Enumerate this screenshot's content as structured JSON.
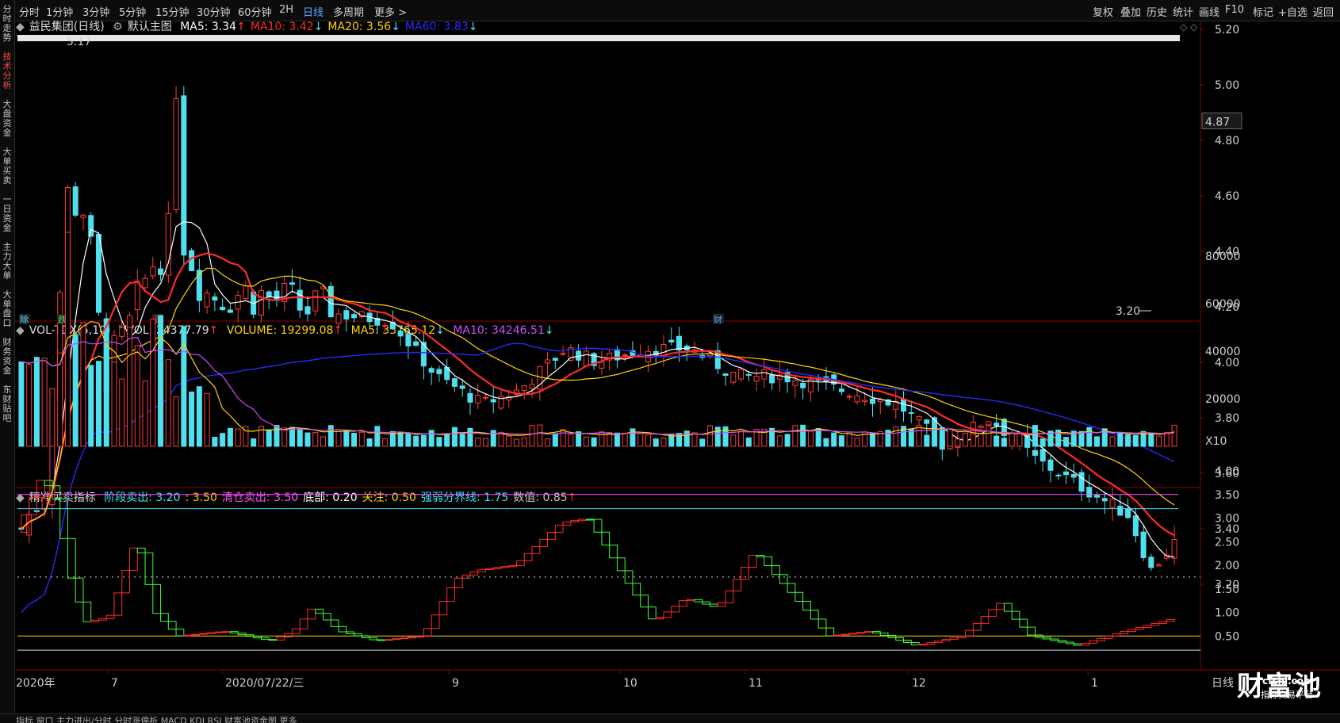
{
  "toolbar": {
    "periods": [
      "分时",
      "1分钟",
      "3分钟",
      "5分钟",
      "15分钟",
      "30分钟",
      "60分钟",
      "2H",
      "日线",
      "多周期",
      "更多 >"
    ],
    "active_period": "日线",
    "right_items": [
      "复权",
      "叠加",
      "历史",
      "统计",
      "画线",
      "F10",
      "标记",
      "+自选",
      "返回"
    ]
  },
  "leftbar": {
    "items": [
      "分时走势",
      "技术分析",
      "大盘资金",
      "大单买卖",
      "一日资金",
      "主力大单",
      "大单盘口",
      "财务资金",
      "东财贴吧"
    ],
    "active": "技术分析"
  },
  "main_chart": {
    "title": "益民集团(日线)",
    "template": "默认主图",
    "ma": [
      {
        "label": "MA5: 3.34",
        "arrow": "↑",
        "color": "#ffffff"
      },
      {
        "label": "MA10: 3.42",
        "arrow": "↓",
        "color": "#ff2a2a"
      },
      {
        "label": "MA20: 3.56",
        "arrow": "↓",
        "color": "#ffd400"
      },
      {
        "label": "MA60: 3.83",
        "arrow": "↓",
        "color": "#2929ff"
      }
    ],
    "high_label": "5.17",
    "low_label": "3.20",
    "current_price": "4.87",
    "y_ticks": [
      "5.20",
      "5.00",
      "4.80",
      "4.60",
      "4.40",
      "4.20",
      "4.00",
      "3.80",
      "3.60",
      "3.40",
      "3.20"
    ],
    "event_marks": [
      "除",
      "跌",
      "涨",
      "财"
    ]
  },
  "volume_chart": {
    "title": "VOL-TDX(5,10)",
    "vvol": "VVOL: 24377.79",
    "vvol_arrow": "↑",
    "volume": "VOLUME: 19299.08",
    "volume_arrow": "↑",
    "ma5": "MA5: 33765.12",
    "ma5_arrow": "↓",
    "ma10": "MA10: 34246.51",
    "ma10_arrow": "↓",
    "y_ticks": [
      "80000",
      "60000",
      "40000",
      "20000",
      "X10"
    ]
  },
  "indicator_chart": {
    "title": "精准买卖指标",
    "items": [
      {
        "label": "阶段卖出: 3.20",
        "color": "#40e0ff"
      },
      {
        "label": ": 3.50",
        "color": "#ffd400"
      },
      {
        "label": "清仓卖出: 3.50",
        "color": "#ff4fff"
      },
      {
        "label": "底部: 0.20",
        "color": "#ffffff"
      },
      {
        "label": "关注: 0.50",
        "color": "#ffd400"
      },
      {
        "label": "强弱分界线: 1.75",
        "color": "#40e0ff"
      },
      {
        "label": "数值: 0.85",
        "color": "#c8c8c8"
      }
    ],
    "value_arrow": "↑",
    "y_ticks": [
      "4.00",
      "3.50",
      "3.00",
      "2.50",
      "2.00",
      "1.50",
      "1.00",
      "0.50"
    ]
  },
  "x_axis": {
    "labels": [
      "2020年",
      "7",
      "2020/07/22/三",
      "9",
      "10",
      "11",
      "12",
      "1"
    ],
    "period_label": "日线"
  },
  "bottom_text": "指标  窗口  主力进出/分时  分时涨停析  MACD  KDJ  RSI  财富池资金图  更多",
  "logo": {
    "big": "财富池",
    "site": "cfchi.com",
    "sub": "指标交易平台"
  },
  "colors": {
    "up": "#ff3b3b",
    "down": "#4fe0ef",
    "ma5": "#ffffff",
    "ma10": "#ff2a2a",
    "ma20": "#ffd400",
    "ma60": "#2929ff"
  }
}
